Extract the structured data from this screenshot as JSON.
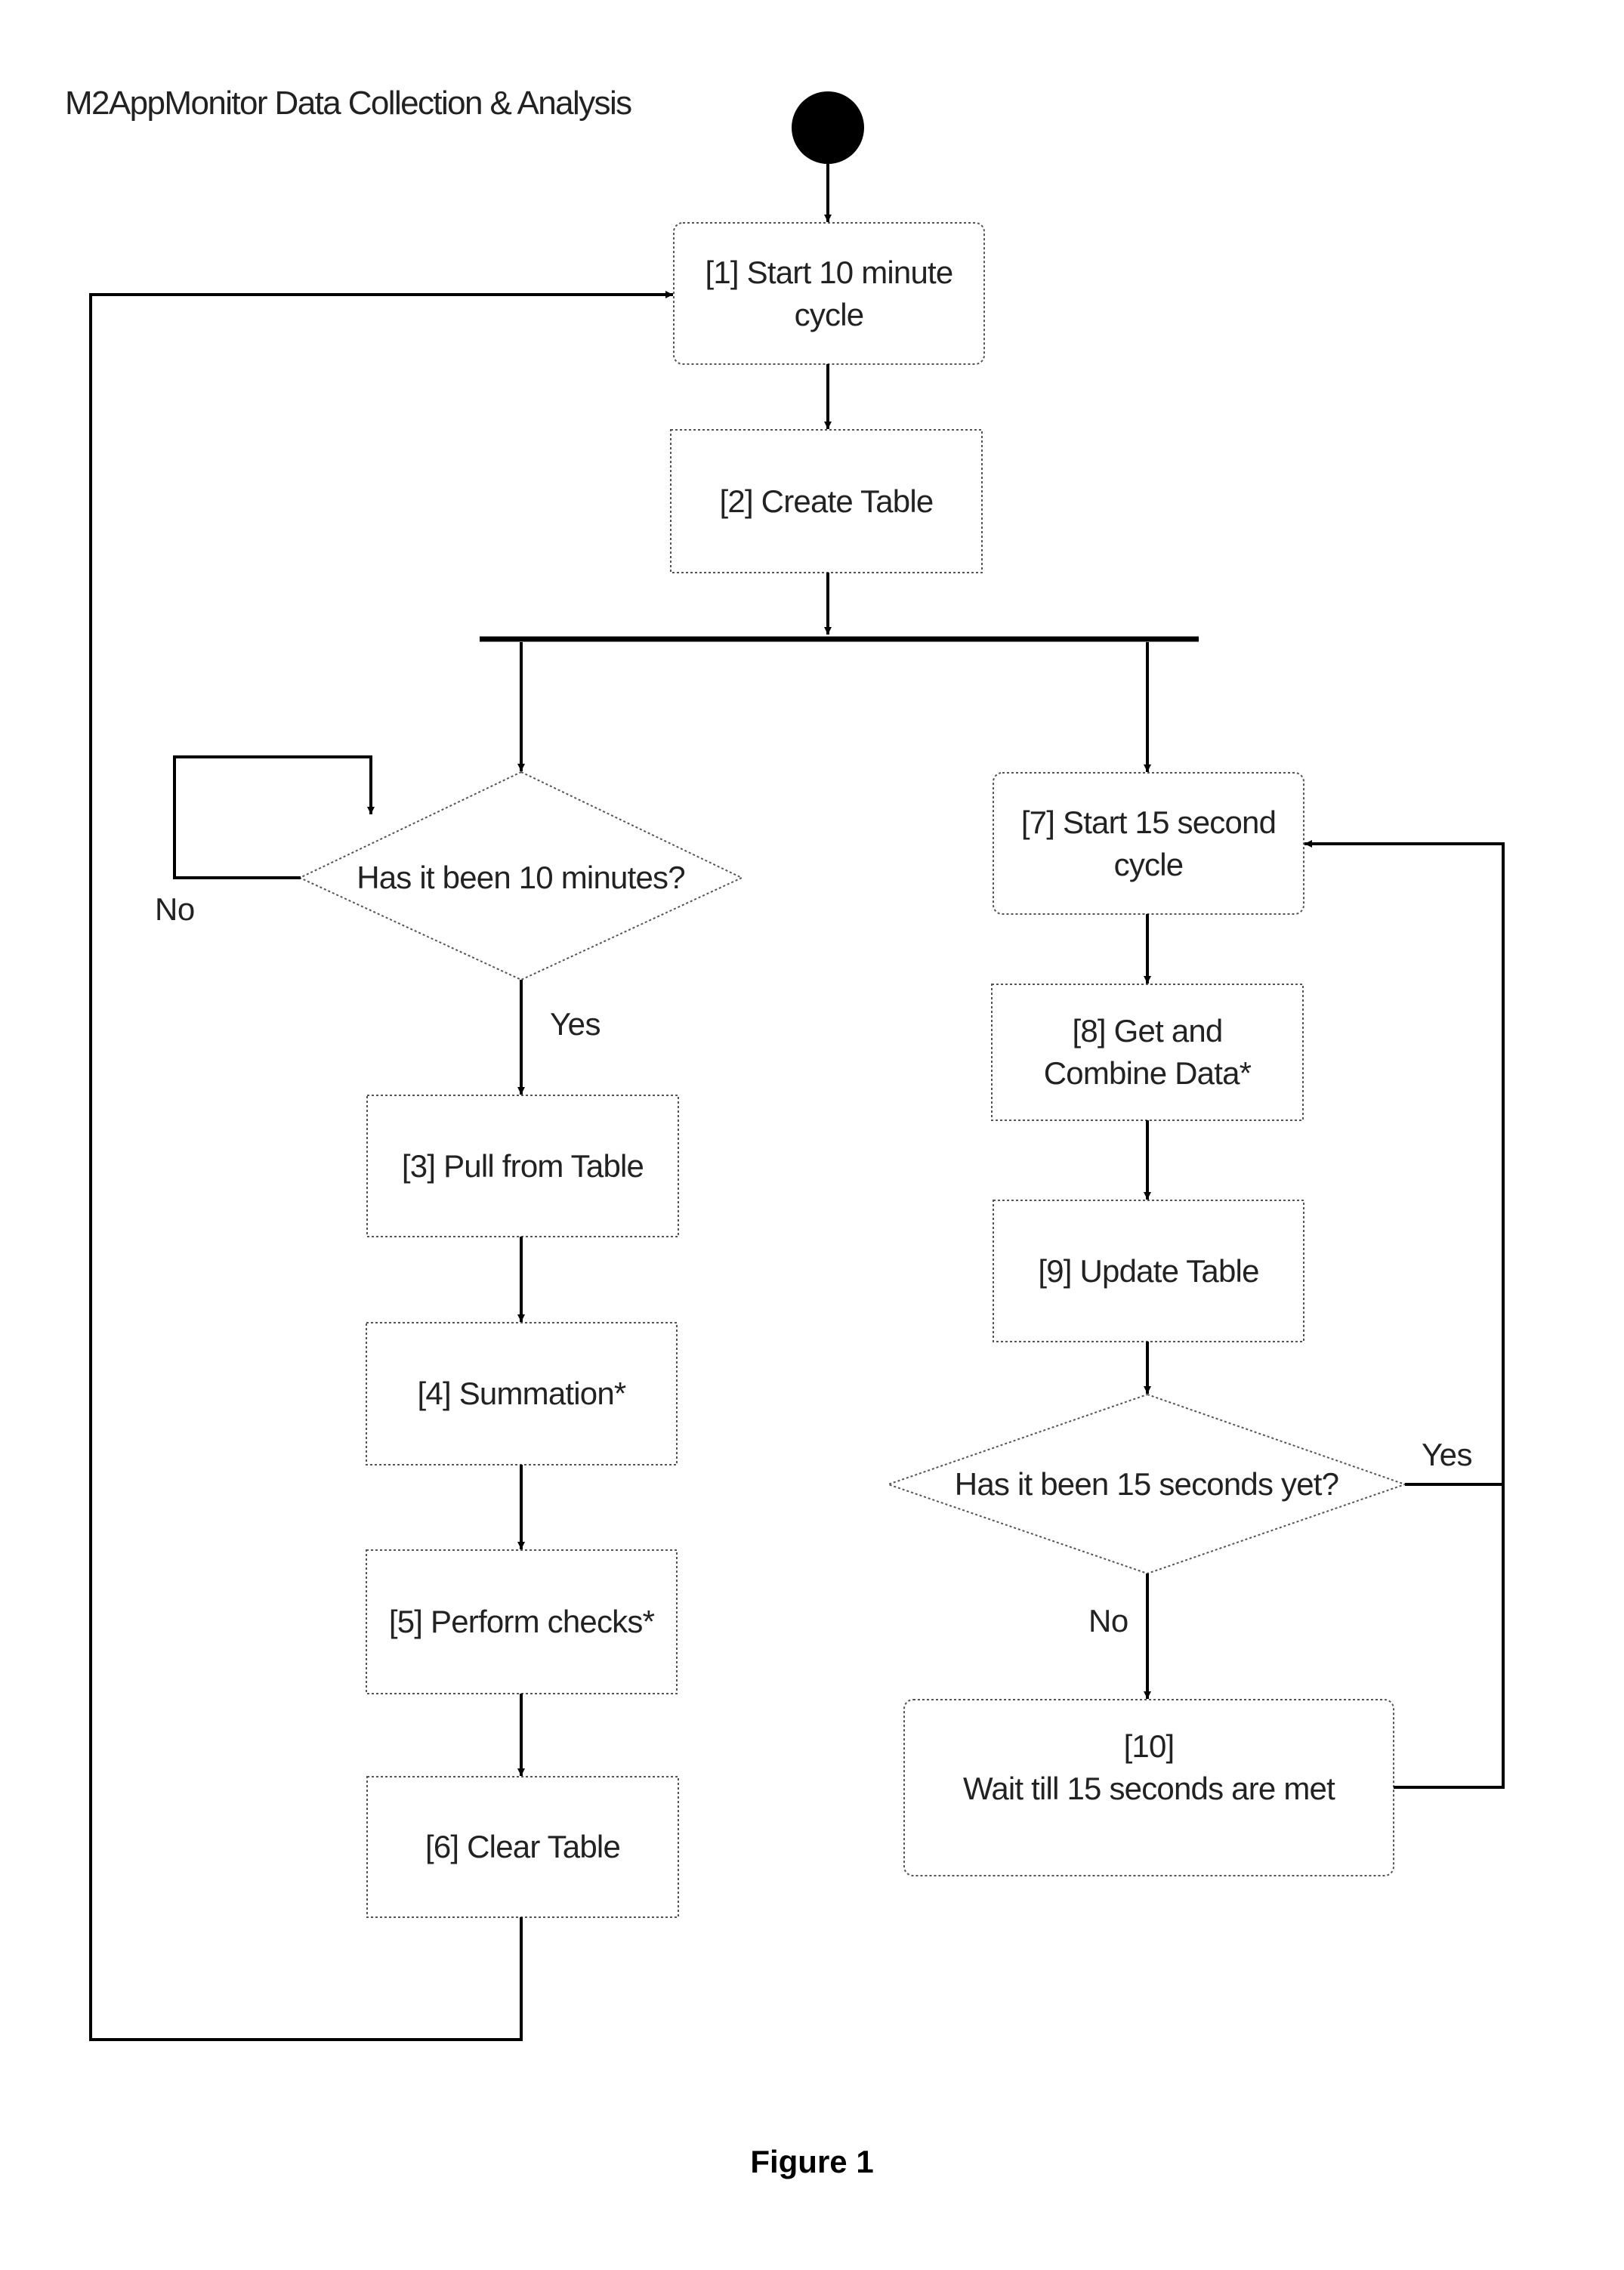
{
  "title": "M2AppMonitor Data Collection & Analysis",
  "caption": "Figure 1",
  "colors": {
    "line": "#000000",
    "node_border": "#555555",
    "background": "#ffffff"
  },
  "nodes": {
    "start": {
      "type": "initial-node"
    },
    "n1": {
      "type": "action",
      "label": "[1] Start  10 minute\ncycle"
    },
    "n2": {
      "type": "action",
      "label": "[2] Create Table"
    },
    "fork": {
      "type": "fork-bar"
    },
    "d1": {
      "type": "decision",
      "label": "Has it been 10 minutes?"
    },
    "n3": {
      "type": "action",
      "label": "[3] Pull from Table"
    },
    "n4": {
      "type": "action",
      "label": "[4] Summation*"
    },
    "n5": {
      "type": "action",
      "label": "[5] Perform checks*"
    },
    "n6": {
      "type": "action",
      "label": "[6] Clear Table"
    },
    "n7": {
      "type": "action",
      "label": "[7] Start 15 second\ncycle"
    },
    "n8": {
      "type": "action",
      "label": "[8] Get and\nCombine Data*"
    },
    "n9": {
      "type": "action",
      "label": "[9] Update Table"
    },
    "d2": {
      "type": "decision",
      "label": "Has it been 15 seconds yet?"
    },
    "n10": {
      "type": "action",
      "label": "[10]\nWait till 15 seconds are met"
    }
  },
  "edge_labels": {
    "d1_no": "No",
    "d1_yes": "Yes",
    "d2_yes": "Yes",
    "d2_no": "No"
  },
  "edges": [
    {
      "from": "start",
      "to": "n1"
    },
    {
      "from": "n1",
      "to": "n2"
    },
    {
      "from": "n2",
      "to": "fork"
    },
    {
      "from": "fork",
      "to": "d1"
    },
    {
      "from": "fork",
      "to": "n7"
    },
    {
      "from": "d1",
      "to": "d1",
      "label": "No"
    },
    {
      "from": "d1",
      "to": "n3",
      "label": "Yes"
    },
    {
      "from": "n3",
      "to": "n4"
    },
    {
      "from": "n4",
      "to": "n5"
    },
    {
      "from": "n5",
      "to": "n6"
    },
    {
      "from": "n6",
      "to": "n1"
    },
    {
      "from": "n7",
      "to": "n8"
    },
    {
      "from": "n8",
      "to": "n9"
    },
    {
      "from": "n9",
      "to": "d2"
    },
    {
      "from": "d2",
      "to": "n7",
      "label": "Yes"
    },
    {
      "from": "d2",
      "to": "n10",
      "label": "No"
    },
    {
      "from": "n10",
      "to": "n7"
    }
  ]
}
